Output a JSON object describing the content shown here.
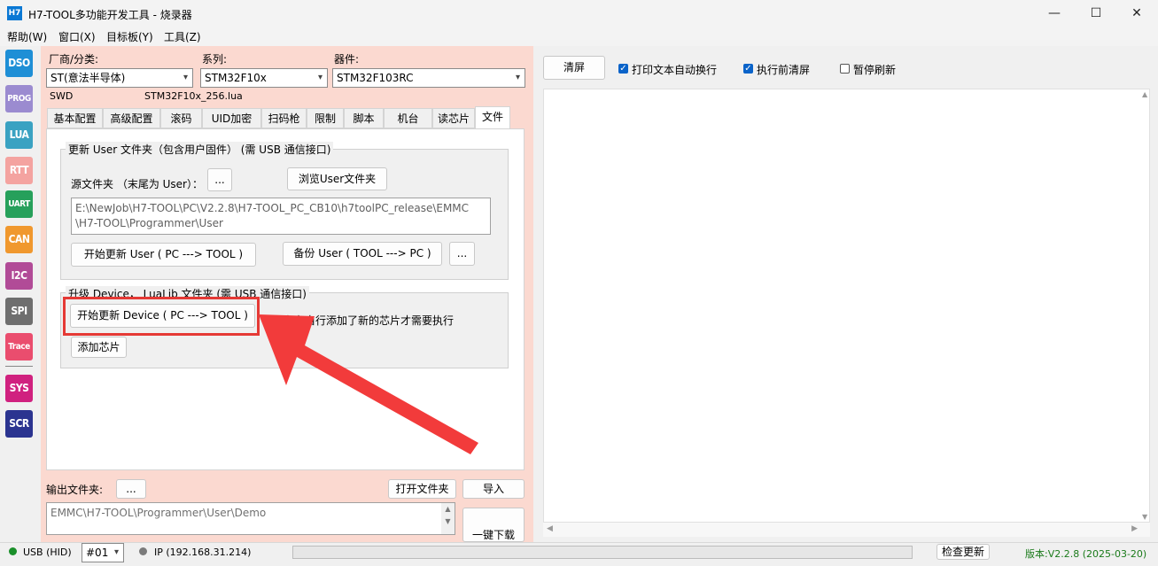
{
  "window": {
    "app_icon": "H7",
    "title": "H7-TOOL多功能开发工具 - 烧录器",
    "controls": [
      "—",
      "☐",
      "✕"
    ]
  },
  "menu": [
    "帮助(W)",
    "窗口(X)",
    "目标板(Y)",
    "工具(Z)"
  ],
  "toolstrip": [
    {
      "label": "DSO",
      "color": "#1e8fd6"
    },
    {
      "label": "PROG",
      "color": "#9b8bd0"
    },
    {
      "label": "LUA",
      "color": "#3aa2c2"
    },
    {
      "label": "RTT",
      "color": "#f4a3a0"
    },
    {
      "label": "UART",
      "color": "#26a05b"
    },
    {
      "label": "CAN",
      "color": "#f0982e"
    },
    {
      "label": "I2C",
      "color": "#b14b97"
    },
    {
      "label": "SPI",
      "color": "#6e6e6e"
    },
    {
      "label": "Trace",
      "color": "#ea4d6e"
    },
    {
      "label": "SYS",
      "color": "#d0217f"
    },
    {
      "label": "SCR",
      "color": "#2b3490"
    }
  ],
  "selectors": {
    "vendor_label": "厂商/分类:",
    "vendor_value": "ST(意法半导体)",
    "series_label": "系列:",
    "series_value": "STM32F10x",
    "device_label": "器件:",
    "device_value": "STM32F103RC",
    "interface": "SWD",
    "lua_file": "STM32F10x_256.lua"
  },
  "tabs": [
    "基本配置",
    "高级配置",
    "滚码",
    "UID加密",
    "扫码枪",
    "限制",
    "脚本",
    "机台",
    "读芯片",
    "文件"
  ],
  "file_tab": {
    "group1_title": "更新 User 文件夹（包含用户固件）   (需 USB 通信接口)",
    "source_label": "源文件夹 （末尾为 User）：",
    "source_browse_btn": "...",
    "browse_user_btn": "浏览User文件夹",
    "path_line1": "E:\\NewJob\\H7-TOOL\\PC\\V2.2.8\\H7-TOOL_PC_CB10\\h7toolPC_release\\EMMC",
    "path_line2": "\\H7-TOOL\\Programmer\\User",
    "start_update_user_btn": "开始更新 User ( PC ---> TOOL )",
    "backup_user_btn": "备份 User ( TOOL ---> PC )",
    "backup_more_btn": "...",
    "group2_title": "升级 Device，  LuaLib 文件夹      (需 USB 通信接口)",
    "start_update_device_btn": "开始更新 Device ( PC ---> TOOL )",
    "note": "只有在自行添加了新的芯片才需要执行",
    "add_chip_btn": "添加芯片"
  },
  "output": {
    "label": "输出文件夹:",
    "browse_btn": "...",
    "open_folder_btn": "打开文件夹",
    "import_btn": "导入",
    "path": "EMMC\\H7-TOOL\\Programmer\\User\\Demo",
    "one_click_btn": "一键下载"
  },
  "right": {
    "clear_btn": "清屏",
    "auto_wrap_label": "打印文本自动换行",
    "auto_wrap_checked": true,
    "clear_before_exec_label": "执行前清屏",
    "clear_before_exec_checked": true,
    "pause_refresh_label": "暂停刷新",
    "pause_refresh_checked": false
  },
  "status": {
    "usb": "USB (HID)",
    "usb_color": "#1a8f2a",
    "device_no": "#01",
    "ip": "IP (192.168.31.214)",
    "ip_color": "#7a7a7a",
    "progress": 0,
    "check_update_btn": "检查更新",
    "version": "版本:V2.2.8 (2025-03-20)",
    "version_color": "#1a7a1a"
  },
  "annotation": {
    "highlight_color": "#e53935",
    "arrow_color": "#f23b3b"
  }
}
